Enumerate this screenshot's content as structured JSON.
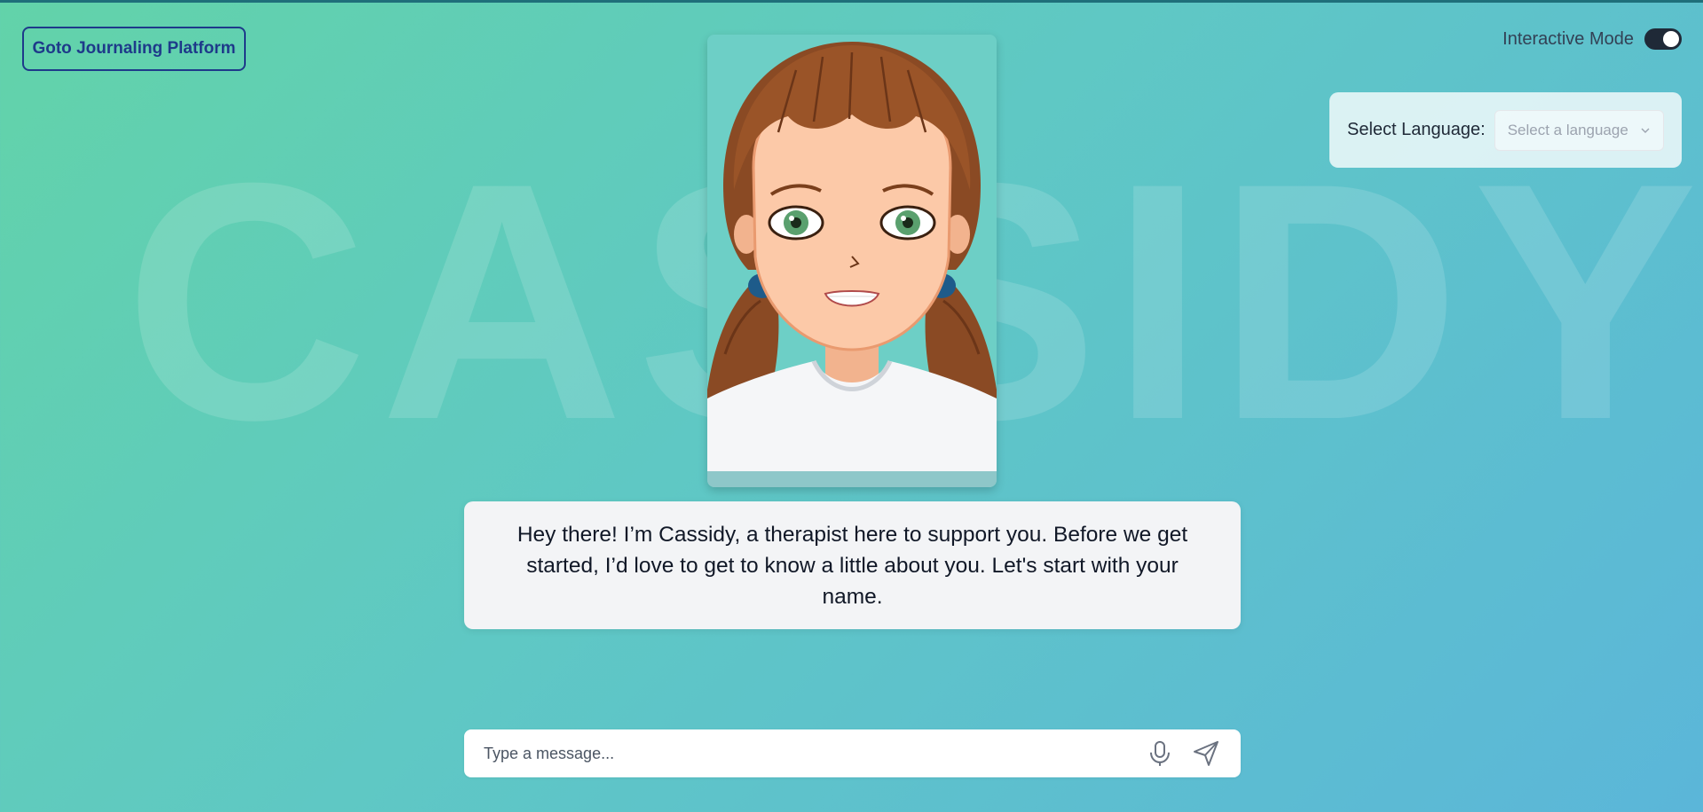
{
  "background": {
    "watermark_text": "CASSIDY"
  },
  "header": {
    "journal_button_label": "Goto Journaling Platform",
    "mode_label": "Interactive Mode",
    "mode_toggle_on": true
  },
  "language": {
    "label": "Select Language:",
    "placeholder": "Select a language",
    "chevron_icon": "chevron-down-icon"
  },
  "avatar": {
    "icon": "therapist-avatar"
  },
  "message": {
    "text": "Hey there! I’m Cassidy, a therapist here to support you. Before we get started, I’d love to get to know a little about you. Let's start with your name."
  },
  "composer": {
    "placeholder": "Type a message...",
    "value": "",
    "mic_icon": "microphone-icon",
    "send_icon": "send-icon"
  },
  "colors": {
    "accent": "#1e3a8a",
    "gradient_start": "#62d3a9",
    "gradient_end": "#5bb6d9",
    "toggle_on": "#1f2937"
  }
}
